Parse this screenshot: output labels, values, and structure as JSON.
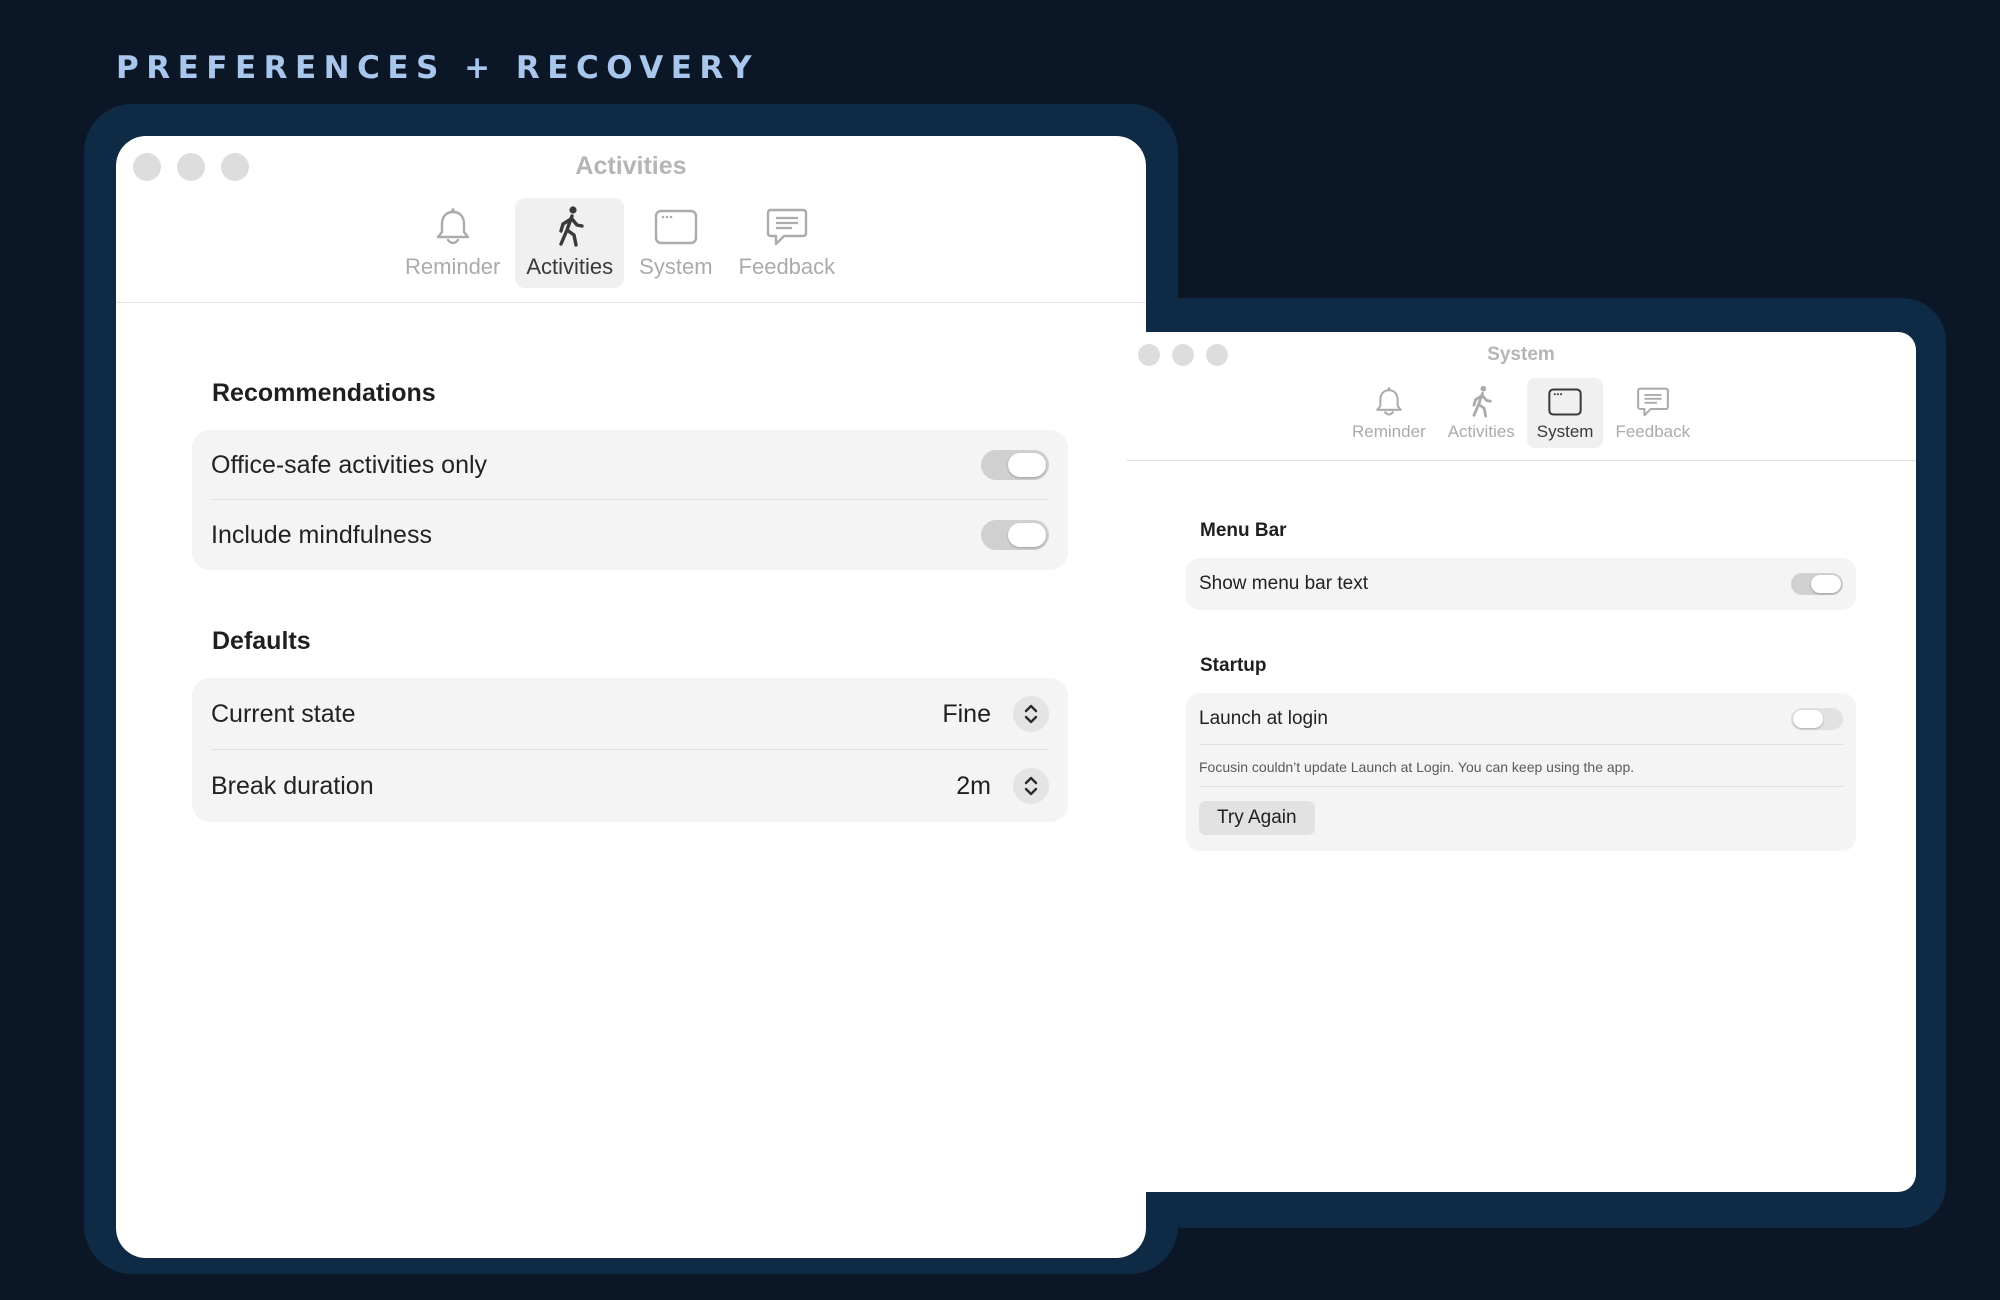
{
  "headline": "PREFERENCES + RECOVERY",
  "colors": {
    "background": "#0b1727",
    "frame": "#0f2a44",
    "headline": "#a9c6ec",
    "window": "#ffffff",
    "group": "#f4f4f4"
  },
  "tabs": [
    {
      "label": "Reminder",
      "icon": "bell-icon"
    },
    {
      "label": "Activities",
      "icon": "walking-person-icon"
    },
    {
      "label": "System",
      "icon": "window-icon"
    },
    {
      "label": "Feedback",
      "icon": "speech-bubble-icon"
    }
  ],
  "activities_window": {
    "title": "Activities",
    "active_tab": "Activities",
    "recommendations": {
      "title": "Recommendations",
      "rows": [
        {
          "label": "Office-safe activities only",
          "on": true
        },
        {
          "label": "Include mindfulness",
          "on": true
        }
      ]
    },
    "defaults": {
      "title": "Defaults",
      "rows": [
        {
          "label": "Current state",
          "value": "Fine"
        },
        {
          "label": "Break duration",
          "value": "2m"
        }
      ]
    }
  },
  "system_window": {
    "title": "System",
    "active_tab": "System",
    "menu_bar": {
      "title": "Menu Bar",
      "rows": [
        {
          "label": "Show menu bar text",
          "on": true
        }
      ]
    },
    "startup": {
      "title": "Startup",
      "launch_label": "Launch at login",
      "launch_on": false,
      "error_message": "Focusin couldn’t update Launch at Login. You can keep using the app.",
      "retry_label": "Try Again"
    }
  }
}
